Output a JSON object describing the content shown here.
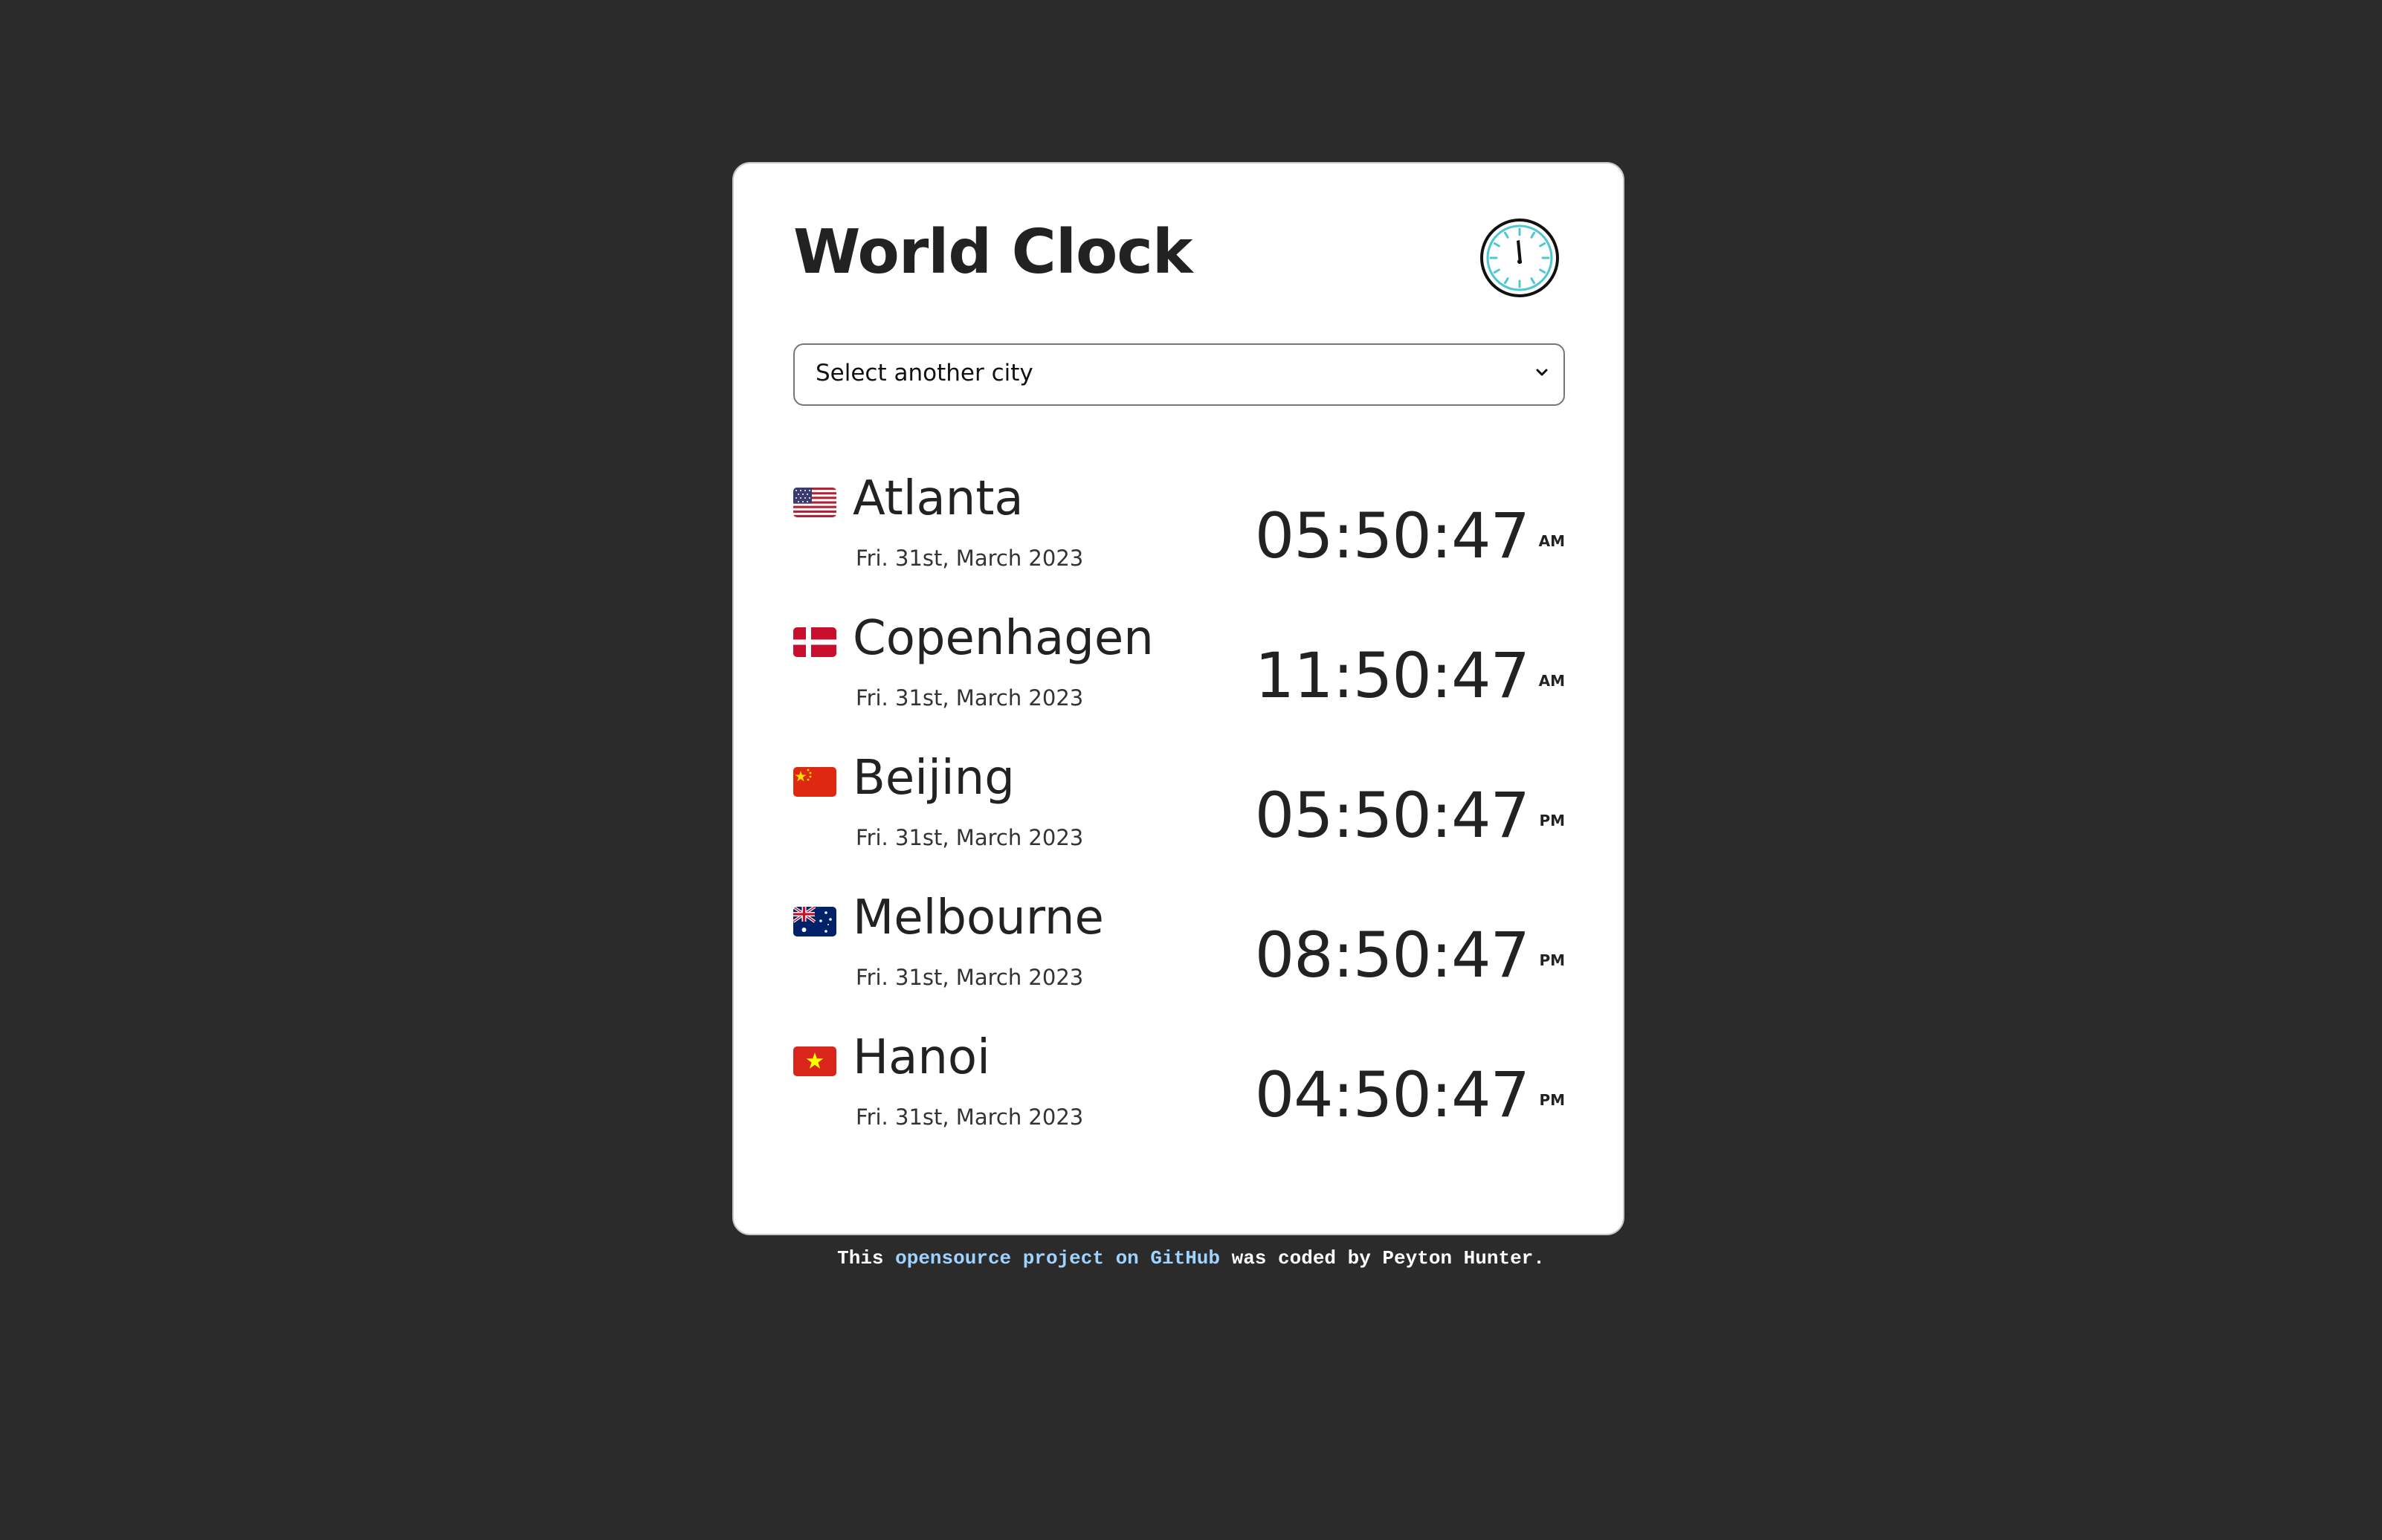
{
  "app": {
    "title": "World Clock"
  },
  "city_select": {
    "placeholder": "Select another city"
  },
  "cities": [
    {
      "name": "Atlanta",
      "flag": "us-flag",
      "date": "Fri. 31st, March 2023",
      "time": "05:50:47",
      "ampm": "AM"
    },
    {
      "name": "Copenhagen",
      "flag": "denmark-flag",
      "date": "Fri. 31st, March 2023",
      "time": "11:50:47",
      "ampm": "AM"
    },
    {
      "name": "Beijing",
      "flag": "china-flag",
      "date": "Fri. 31st, March 2023",
      "time": "05:50:47",
      "ampm": "PM"
    },
    {
      "name": "Melbourne",
      "flag": "australia-flag",
      "date": "Fri. 31st, March 2023",
      "time": "08:50:47",
      "ampm": "PM"
    },
    {
      "name": "Hanoi",
      "flag": "vietnam-flag",
      "date": "Fri. 31st, March 2023",
      "time": "04:50:47",
      "ampm": "PM"
    }
  ],
  "footer": {
    "prefix": "This ",
    "link_text": "opensource project on GitHub",
    "suffix": " was coded by Peyton Hunter."
  },
  "colors": {
    "background": "#2b2b2b",
    "card": "#ffffff",
    "text": "#222222",
    "footer_link": "#9fd3ff",
    "clock_accent": "#4cc7d4"
  },
  "icons": {
    "header": "clock-icon",
    "select": "chevron-down-icon"
  }
}
